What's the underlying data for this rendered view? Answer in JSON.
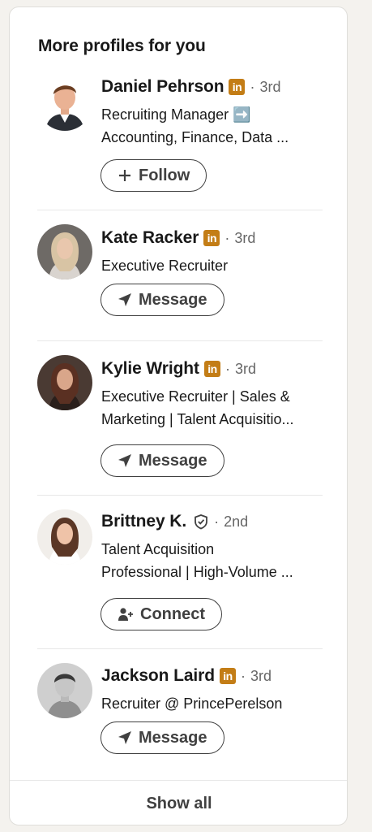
{
  "card": {
    "title": "More profiles for you",
    "show_all_label": "Show all"
  },
  "colors": {
    "linkedin_badge": "#c37d16",
    "button_border": "#404040",
    "secondary_text": "#666666"
  },
  "profiles": [
    {
      "name": "Daniel Pehrson",
      "badge": "linkedin-premium-icon",
      "separator": "·",
      "degree": "3rd",
      "headline_line1": "Recruiting Manager ➡️",
      "headline_line2": "Accounting, Finance, Data ...",
      "action_label": "Follow",
      "action_icon": "plus-icon"
    },
    {
      "name": "Kate Racker",
      "badge": "linkedin-premium-icon",
      "separator": "·",
      "degree": "3rd",
      "headline_line1": "Executive Recruiter",
      "headline_line2": "",
      "action_label": "Message",
      "action_icon": "send-icon"
    },
    {
      "name": "Kylie Wright",
      "badge": "linkedin-premium-icon",
      "separator": "·",
      "degree": "3rd",
      "headline_line1": "Executive Recruiter | Sales &",
      "headline_line2": "Marketing | Talent Acquisitio...",
      "action_label": "Message",
      "action_icon": "send-icon"
    },
    {
      "name": "Brittney K.",
      "badge": "verified-shield-icon",
      "separator": "·",
      "degree": "2nd",
      "headline_line1": "Talent Acquisition",
      "headline_line2": "Professional | High-Volume ...",
      "action_label": "Connect",
      "action_icon": "add-person-icon"
    },
    {
      "name": "Jackson Laird",
      "badge": "linkedin-premium-icon",
      "separator": "·",
      "degree": "3rd",
      "headline_line1": "Recruiter @ PrincePerelson",
      "headline_line2": "",
      "action_label": "Message",
      "action_icon": "send-icon"
    }
  ]
}
